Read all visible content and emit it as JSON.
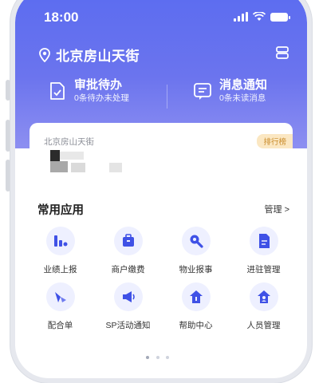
{
  "status_bar": {
    "time": "18:00"
  },
  "header": {
    "location": "北京房山天街"
  },
  "quick": [
    {
      "title": "审批待办",
      "subtitle": "0条待办未处理"
    },
    {
      "title": "消息通知",
      "subtitle": "0条未读消息"
    }
  ],
  "card": {
    "name": "北京房山天街",
    "rank_badge": "排行榜"
  },
  "apps_section": {
    "title": "常用应用",
    "manage_label": "管理 >"
  },
  "apps": [
    {
      "label": "业绩上报",
      "icon": "bar-chart-icon"
    },
    {
      "label": "商户缴费",
      "icon": "wallet-icon"
    },
    {
      "label": "物业报事",
      "icon": "wrench-icon"
    },
    {
      "label": "进驻管理",
      "icon": "document-icon"
    },
    {
      "label": "配合单",
      "icon": "direction-icon"
    },
    {
      "label": "SP活动通知",
      "icon": "megaphone-icon"
    },
    {
      "label": "帮助中心",
      "icon": "home-help-icon"
    },
    {
      "label": "人员管理",
      "icon": "people-icon"
    }
  ],
  "colors": {
    "brand": "#5b6cf0",
    "icon_blue": "#3f51e6",
    "badge_bg": "#fbe7c2"
  },
  "pager": {
    "pages": 3,
    "current": 1
  }
}
